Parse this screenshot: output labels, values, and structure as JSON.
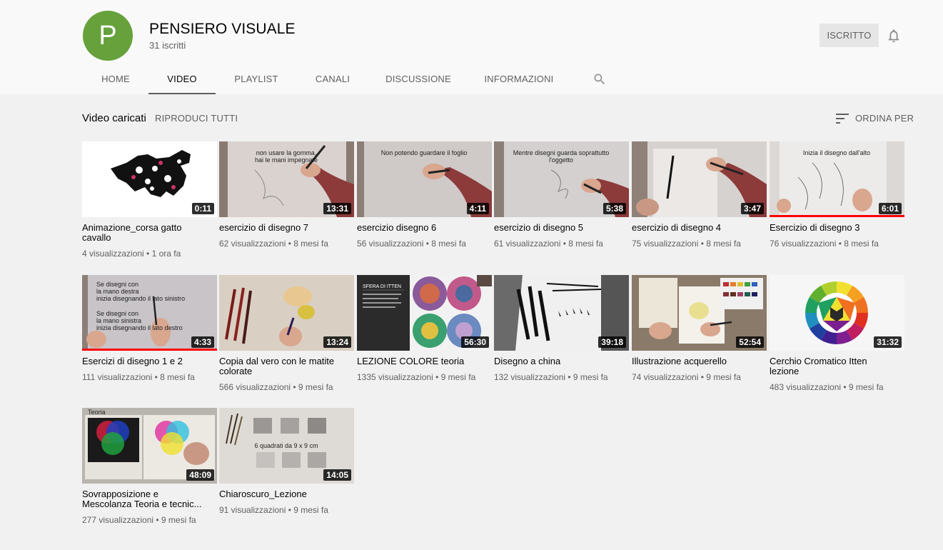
{
  "channel": {
    "avatar_letter": "P",
    "avatar_color": "#66a13b",
    "name": "PENSIERO VISUALE",
    "subscribers": "31 iscritti",
    "subscribe_label": "ISCRITTO",
    "bell_icon": "bell-icon"
  },
  "tabs": [
    {
      "label": "HOME",
      "active": false
    },
    {
      "label": "VIDEO",
      "active": true
    },
    {
      "label": "PLAYLIST",
      "active": false
    },
    {
      "label": "CANALI",
      "active": false
    },
    {
      "label": "DISCUSSIONE",
      "active": false
    },
    {
      "label": "INFORMAZIONI",
      "active": false
    }
  ],
  "section": {
    "title": "Video caricati",
    "play_all": "RIPRODUCI TUTTI",
    "sort_label": "ORDINA PER"
  },
  "videos": [
    {
      "title": "Animazione_corsa gatto cavallo",
      "meta": "4 visualizzazioni • 1 ora fa",
      "duration": "0:11",
      "overlay": "",
      "watched": false
    },
    {
      "title": "esercizio di disegno 7",
      "meta": "62 visualizzazioni • 8 mesi fa",
      "duration": "13:31",
      "overlay": "non usare la gomma, hai le mani impegnate",
      "watched": false
    },
    {
      "title": "esercizio disegno 6",
      "meta": "56 visualizzazioni • 8 mesi fa",
      "duration": "4:11",
      "overlay": "Non potendo guardare il foglio",
      "watched": false
    },
    {
      "title": "esercizio di disegno 5",
      "meta": "61 visualizzazioni • 8 mesi fa",
      "duration": "5:38",
      "overlay": "Mentre disegni guarda soprattutto l'oggetto",
      "watched": false
    },
    {
      "title": "esercizio di disegno 4",
      "meta": "75 visualizzazioni • 8 mesi fa",
      "duration": "3:47",
      "overlay": "",
      "watched": false
    },
    {
      "title": "Esercizio di disegno 3",
      "meta": "76 visualizzazioni • 8 mesi fa",
      "duration": "6:01",
      "overlay": "Inizia il disegno dall'alto",
      "watched": true
    },
    {
      "title": "Esercizi di disegno 1 e 2",
      "meta": "111 visualizzazioni • 8 mesi fa",
      "duration": "4:33",
      "overlay": "Se disegni con la mano destra inizia disegnando il lato sinistro / Se disegni con la mano sinistra inizia disegnando il lato destro",
      "watched": true
    },
    {
      "title": "Copia dal vero con le matite colorate",
      "meta": "566 visualizzazioni • 9 mesi fa",
      "duration": "13:24",
      "overlay": "",
      "watched": false
    },
    {
      "title": "LEZIONE COLORE teoria",
      "meta": "1335 visualizzazioni • 9 mesi fa",
      "duration": "56:30",
      "overlay": "SFERA DI ITTEN",
      "watched": false
    },
    {
      "title": "Disegno a china",
      "meta": "132 visualizzazioni • 9 mesi fa",
      "duration": "39:18",
      "overlay": "",
      "watched": false
    },
    {
      "title": "Illustrazione acquerello",
      "meta": "74 visualizzazioni • 9 mesi fa",
      "duration": "52:54",
      "overlay": "",
      "watched": false
    },
    {
      "title": "Cerchio Cromatico Itten lezione",
      "meta": "483 visualizzazioni • 9 mesi fa",
      "duration": "31:32",
      "overlay": "",
      "watched": false
    },
    {
      "title": "Sovrapposizione e Mescolanza Teoria e tecnic...",
      "meta": "277 visualizzazioni • 9 mesi fa",
      "duration": "48:09",
      "overlay": "Teoria",
      "watched": false
    },
    {
      "title": "Chiaroscuro_Lezione",
      "meta": "91 visualizzazioni • 9 mesi fa",
      "duration": "14:05",
      "overlay": "6 quadrati da 9 x 9 cm",
      "watched": false
    }
  ]
}
